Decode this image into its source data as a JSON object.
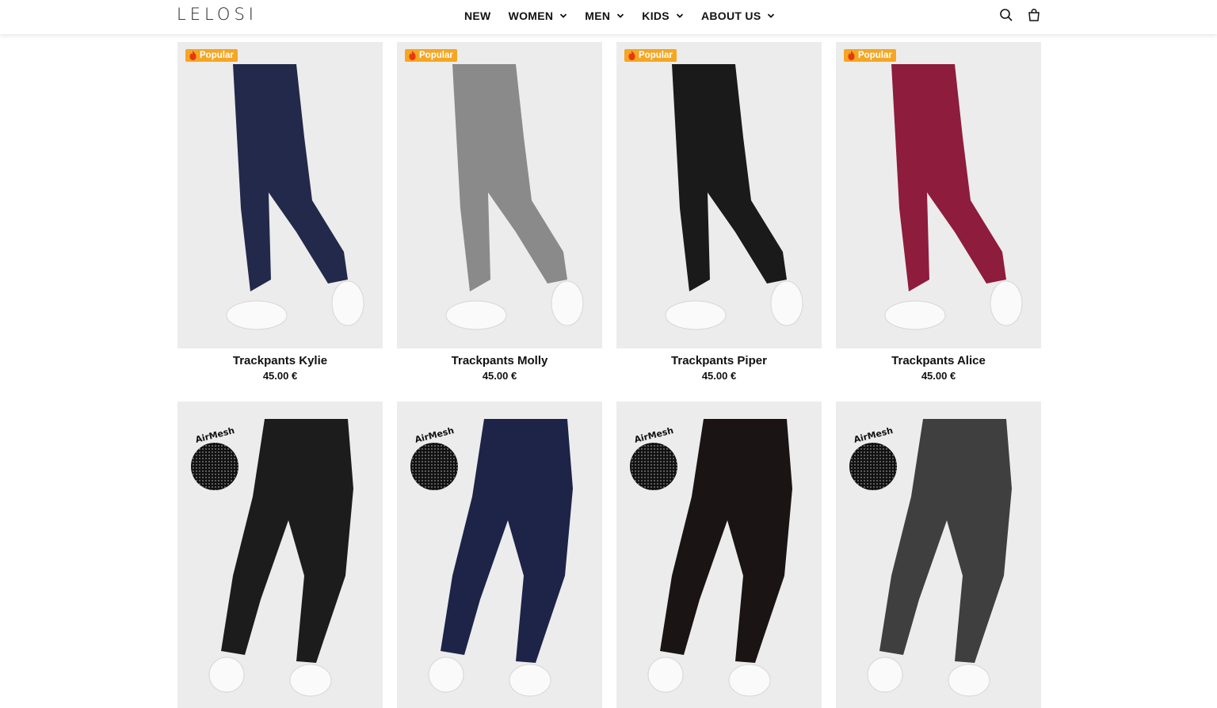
{
  "brand": {
    "logo": "LELOSI"
  },
  "nav": {
    "items": [
      {
        "label": "NEW",
        "has_dropdown": false
      },
      {
        "label": "WOMEN",
        "has_dropdown": true
      },
      {
        "label": "MEN",
        "has_dropdown": true
      },
      {
        "label": "KIDS",
        "has_dropdown": true
      },
      {
        "label": "ABOUT US",
        "has_dropdown": true
      }
    ],
    "icons": [
      "search-icon",
      "shopping-bag-icon"
    ]
  },
  "products": [
    {
      "title": "Trackpants Kylie",
      "price": "45.00 €",
      "badge": "Popular",
      "color": "#23294a"
    },
    {
      "title": "Trackpants Molly",
      "price": "45.00 €",
      "badge": "Popular",
      "color": "#8a8a8a"
    },
    {
      "title": "Trackpants Piper",
      "price": "45.00 €",
      "badge": "Popular",
      "color": "#1a1a1a"
    },
    {
      "title": "Trackpants Alice",
      "price": "45.00 €",
      "badge": "Popular",
      "color": "#8e1c3c"
    },
    {
      "title": "",
      "price": "",
      "feature": "AirMesh",
      "color": "#1c1c1c",
      "pattern": "leaf"
    },
    {
      "title": "",
      "price": "",
      "feature": "AirMesh",
      "color": "#1d2448",
      "pattern": "zebra"
    },
    {
      "title": "",
      "price": "",
      "feature": "AirMesh",
      "color": "#1b1414",
      "pattern": "floral"
    },
    {
      "title": "",
      "price": "",
      "feature": "AirMesh",
      "color": "#3f3f3f",
      "pattern": "camo"
    }
  ],
  "accent_badge_color": "#f5a623"
}
